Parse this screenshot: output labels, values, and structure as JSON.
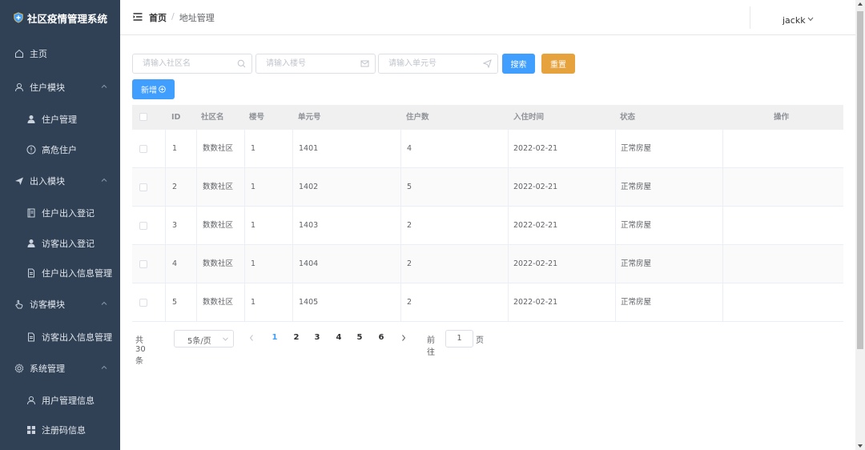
{
  "app": {
    "title": "社区疫情管理系统"
  },
  "sidebar": {
    "items": [
      {
        "label": "主页",
        "icon": "home-icon",
        "level": 1
      },
      {
        "label": "住户模块",
        "icon": "user-icon",
        "level": 1,
        "expanded": true
      },
      {
        "label": "住户管理",
        "icon": "person-filled-icon",
        "level": 2
      },
      {
        "label": "高危住户",
        "icon": "warning-circle-icon",
        "level": 2
      },
      {
        "label": "出入模块",
        "icon": "send-icon",
        "level": 1,
        "expanded": true
      },
      {
        "label": "住户出入登记",
        "icon": "notebook-icon",
        "level": 2
      },
      {
        "label": "访客出入登记",
        "icon": "person-filled-icon",
        "level": 2
      },
      {
        "label": "住户出入信息管理",
        "icon": "document-icon",
        "level": 2
      },
      {
        "label": "访客模块",
        "icon": "pointer-icon",
        "level": 1,
        "expanded": true
      },
      {
        "label": "访客出入信息管理",
        "icon": "document-icon",
        "level": 2
      },
      {
        "label": "系统管理",
        "icon": "gear-icon",
        "level": 1,
        "expanded": true
      },
      {
        "label": "用户管理信息",
        "icon": "user-icon",
        "level": 2
      },
      {
        "label": "注册码信息",
        "icon": "grid-icon",
        "level": 2
      }
    ]
  },
  "header": {
    "breadcrumb": [
      "首页",
      "地址管理"
    ],
    "separator": "/",
    "username": "jackk"
  },
  "search": {
    "community_placeholder": "请输入社区名",
    "building_placeholder": "请输入楼号",
    "unit_placeholder": "请输入单元号",
    "search_label": "搜索",
    "reset_label": "重置",
    "add_label": "新增"
  },
  "table": {
    "columns": [
      "ID",
      "社区名",
      "楼号",
      "单元号",
      "住户数",
      "入住时间",
      "状态",
      "操作"
    ],
    "rows": [
      {
        "id": "1",
        "community": "数数社区",
        "building": "1",
        "unit": "1401",
        "residents": "4",
        "date": "2022-02-21",
        "status": "正常房屋"
      },
      {
        "id": "2",
        "community": "数数社区",
        "building": "1",
        "unit": "1402",
        "residents": "5",
        "date": "2022-02-21",
        "status": "正常房屋"
      },
      {
        "id": "3",
        "community": "数数社区",
        "building": "1",
        "unit": "1403",
        "residents": "2",
        "date": "2022-02-21",
        "status": "正常房屋"
      },
      {
        "id": "4",
        "community": "数数社区",
        "building": "1",
        "unit": "1404",
        "residents": "2",
        "date": "2022-02-21",
        "status": "正常房屋"
      },
      {
        "id": "5",
        "community": "数数社区",
        "building": "1",
        "unit": "1405",
        "residents": "2",
        "date": "2022-02-21",
        "status": "正常房屋"
      }
    ]
  },
  "pagination": {
    "total": "共 30 条",
    "page_size": "5条/页",
    "pages": [
      "1",
      "2",
      "3",
      "4",
      "5",
      "6"
    ],
    "current": "1",
    "goto_label": "前往",
    "goto_value": "1",
    "page_suffix": "页"
  },
  "colors": {
    "sidebar_bg": "#304156",
    "primary": "#409eff",
    "warning": "#e6a23c"
  }
}
